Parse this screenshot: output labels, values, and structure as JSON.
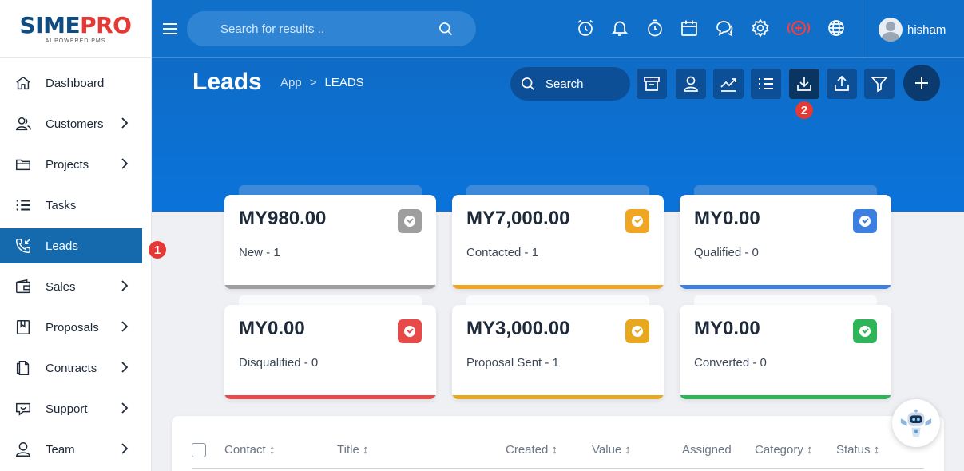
{
  "brand": {
    "name_part1": "SIME",
    "name_part2": "PRO",
    "tagline": "AI POWERED PMS"
  },
  "header": {
    "search_placeholder": "Search for results ..",
    "icons": [
      "alarm-icon",
      "bell-icon",
      "timer-icon",
      "calendar-icon",
      "chat-icon",
      "gear-icon",
      "add-circle-icon",
      "globe-icon"
    ],
    "user_name": "hisham"
  },
  "sidebar": {
    "items": [
      {
        "label": "Dashboard",
        "icon": "home-icon",
        "has_submenu": false,
        "active": false
      },
      {
        "label": "Customers",
        "icon": "customers-icon",
        "has_submenu": true,
        "active": false
      },
      {
        "label": "Projects",
        "icon": "folder-icon",
        "has_submenu": true,
        "active": false
      },
      {
        "label": "Tasks",
        "icon": "list-icon",
        "has_submenu": false,
        "active": false
      },
      {
        "label": "Leads",
        "icon": "phone-incoming-icon",
        "has_submenu": false,
        "active": true
      },
      {
        "label": "Sales",
        "icon": "wallet-icon",
        "has_submenu": true,
        "active": false
      },
      {
        "label": "Proposals",
        "icon": "proposal-icon",
        "has_submenu": true,
        "active": false
      },
      {
        "label": "Contracts",
        "icon": "contract-icon",
        "has_submenu": true,
        "active": false
      },
      {
        "label": "Support",
        "icon": "support-icon",
        "has_submenu": true,
        "active": false
      },
      {
        "label": "Team",
        "icon": "team-icon",
        "has_submenu": true,
        "active": false
      }
    ]
  },
  "markers": {
    "sidebar": "1",
    "toolbar": "2"
  },
  "page": {
    "title": "Leads",
    "breadcrumb_root": "App",
    "breadcrumb_sep": ">",
    "breadcrumb_current": "LEADS",
    "search_label": "Search",
    "toolbar_icons": [
      "archive-icon",
      "user-icon",
      "chart-icon",
      "list-view-icon",
      "download-icon",
      "upload-icon",
      "filter-icon"
    ]
  },
  "cards": [
    {
      "amount": "MY980.00",
      "label": "New - 1",
      "color": "#9e9e9e"
    },
    {
      "amount": "MY7,000.00",
      "label": "Contacted - 1",
      "color": "#f0a623"
    },
    {
      "amount": "MY0.00",
      "label": "Qualified - 0",
      "color": "#3d7fe0"
    },
    {
      "amount": "MY0.00",
      "label": "Disqualified - 0",
      "color": "#e84a4a"
    },
    {
      "amount": "MY3,000.00",
      "label": "Proposal Sent - 1",
      "color": "#e8a81e"
    },
    {
      "amount": "MY0.00",
      "label": "Converted - 0",
      "color": "#2fb45a"
    }
  ],
  "table": {
    "columns": [
      "Contact ↕",
      "Title ↕",
      "Created ↕",
      "Value ↕",
      "Assigned",
      "Category ↕",
      "Status ↕"
    ]
  },
  "colors": {
    "primary": "#0f6fc9",
    "active_nav": "#1569ad",
    "marker": "#e53935"
  }
}
